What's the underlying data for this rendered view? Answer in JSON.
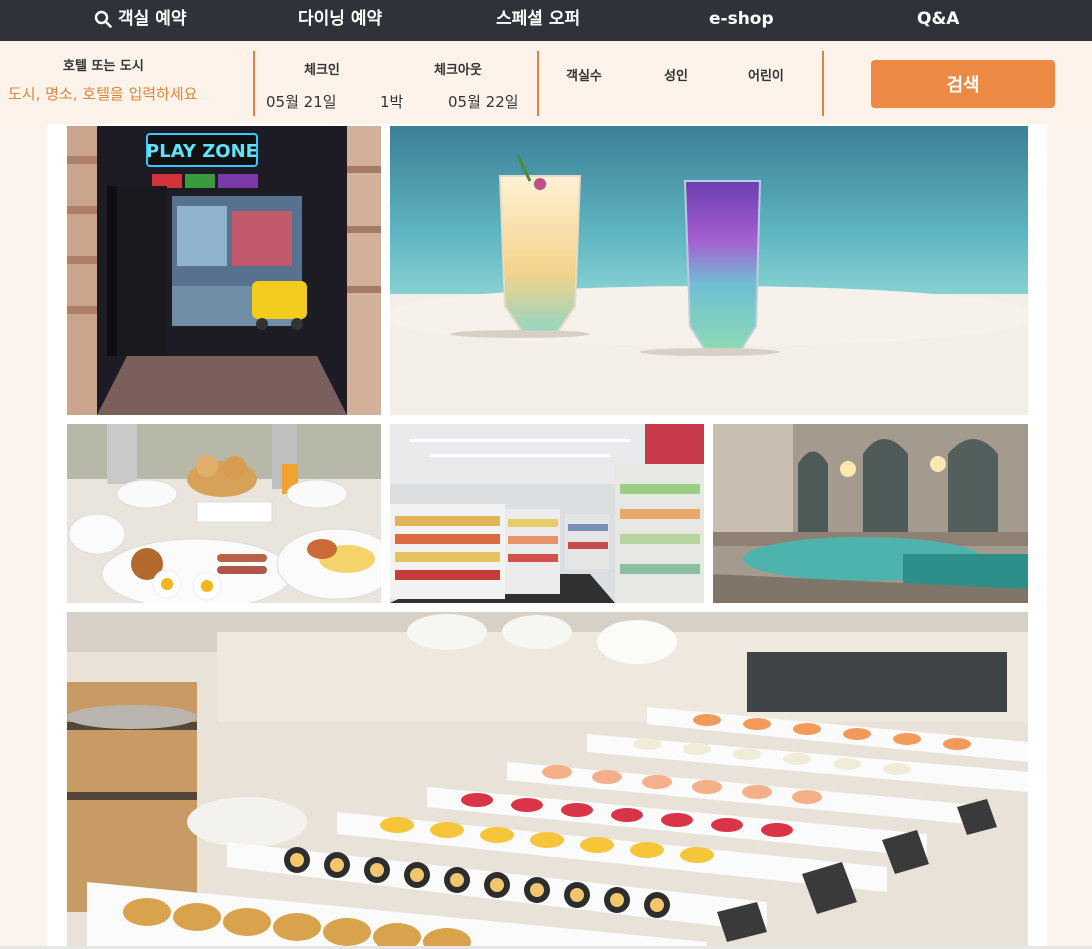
{
  "nav": {
    "items": [
      {
        "label": "객실 예약",
        "icon": "search-icon"
      },
      {
        "label": "다이닝 예약"
      },
      {
        "label": "스페셜 오퍼"
      },
      {
        "label": "e-shop"
      },
      {
        "label": "Q&A"
      }
    ]
  },
  "search": {
    "destination_label": "호텔 또는 도시",
    "destination_placeholder": "도시, 명소, 호텔을 입력하세요",
    "checkin_label": "체크인",
    "checkout_label": "체크아웃",
    "checkin_date": "05월 21일",
    "nights": "1박",
    "checkout_date": "05월 22일",
    "rooms_label": "객실수",
    "adults_label": "성인",
    "children_label": "어린이",
    "button_label": "검색"
  },
  "gallery": {
    "photos": [
      {
        "subject": "play zone entrance",
        "sign": "PLAY ZONE"
      },
      {
        "subject": "two cocktails by the sea"
      },
      {
        "subject": "breakfast buffet table"
      },
      {
        "subject": "convenience store aisle"
      },
      {
        "subject": "indoor spa bath"
      },
      {
        "subject": "sushi buffet"
      }
    ]
  },
  "colors": {
    "nav_bg": "#2f3238",
    "accent": "#ec8a45",
    "page_bg": "#fbf3ec"
  }
}
